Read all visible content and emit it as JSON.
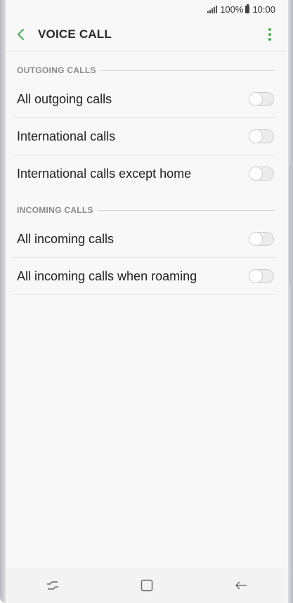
{
  "status_bar": {
    "battery_percent": "100%",
    "time": "10:00",
    "icons": [
      "signal-icon",
      "battery-icon"
    ]
  },
  "app_bar": {
    "title": "VOICE CALL",
    "back_icon": "chevron-left-icon",
    "more_icon": "more-vertical-icon"
  },
  "sections": [
    {
      "header": "OUTGOING CALLS",
      "items": [
        {
          "label": "All outgoing calls",
          "enabled": false
        },
        {
          "label": "International calls",
          "enabled": false
        },
        {
          "label": "International calls except home",
          "enabled": false
        }
      ]
    },
    {
      "header": "INCOMING CALLS",
      "items": [
        {
          "label": "All incoming calls",
          "enabled": false
        },
        {
          "label": "All incoming calls when roaming",
          "enabled": false
        }
      ]
    }
  ],
  "nav_bar": {
    "icons": [
      "recent-apps-icon",
      "home-icon",
      "back-icon"
    ]
  },
  "colors": {
    "accent": "#4caf50",
    "background": "#f8f8f8",
    "text": "#212121",
    "section_header": "#8a8a8a"
  }
}
